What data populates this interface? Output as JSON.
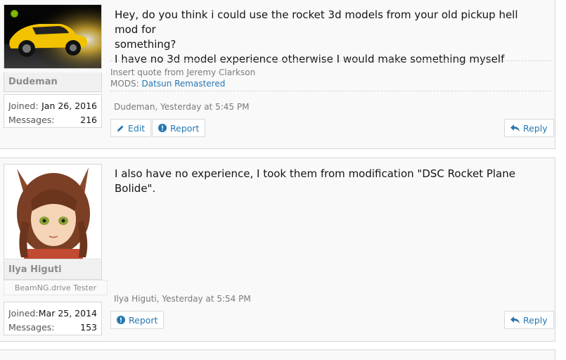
{
  "posts": [
    {
      "author": "Dudeman",
      "online": true,
      "joined_label": "Joined:",
      "joined": "Jan 26, 2016",
      "messages_label": "Messages:",
      "messages": "216",
      "message_lines": [
        "Hey, do you think i could use the rocket 3d models from your old pickup hell mod for",
        "something?",
        "I have no 3d model experience otherwise I would make something myself"
      ],
      "signature": {
        "line1": "Insert quote from Jeremy Clarkson",
        "mods_label": "MODS:",
        "mods_link": "Datsun Remastered"
      },
      "meta": "Dudeman, Yesterday at 5:45 PM",
      "edit_label": "Edit",
      "report_label": "Report",
      "reply_label": "Reply"
    },
    {
      "author": "Ilya Higuti",
      "user_title": "BeamNG.drive Tester",
      "joined_label": "Joined:",
      "joined": "Mar 25, 2014",
      "messages_label": "Messages:",
      "messages": "153",
      "message_lines": [
        "I also have no experience, I took them from modification \"DSC Rocket Plane Bolide\"."
      ],
      "meta": "Ilya Higuti, Yesterday at 5:54 PM",
      "report_label": "Report",
      "reply_label": "Reply"
    }
  ],
  "colors": {
    "link": "#2577b1",
    "online": "#7fb900",
    "car_yellow": "#f2c200"
  }
}
